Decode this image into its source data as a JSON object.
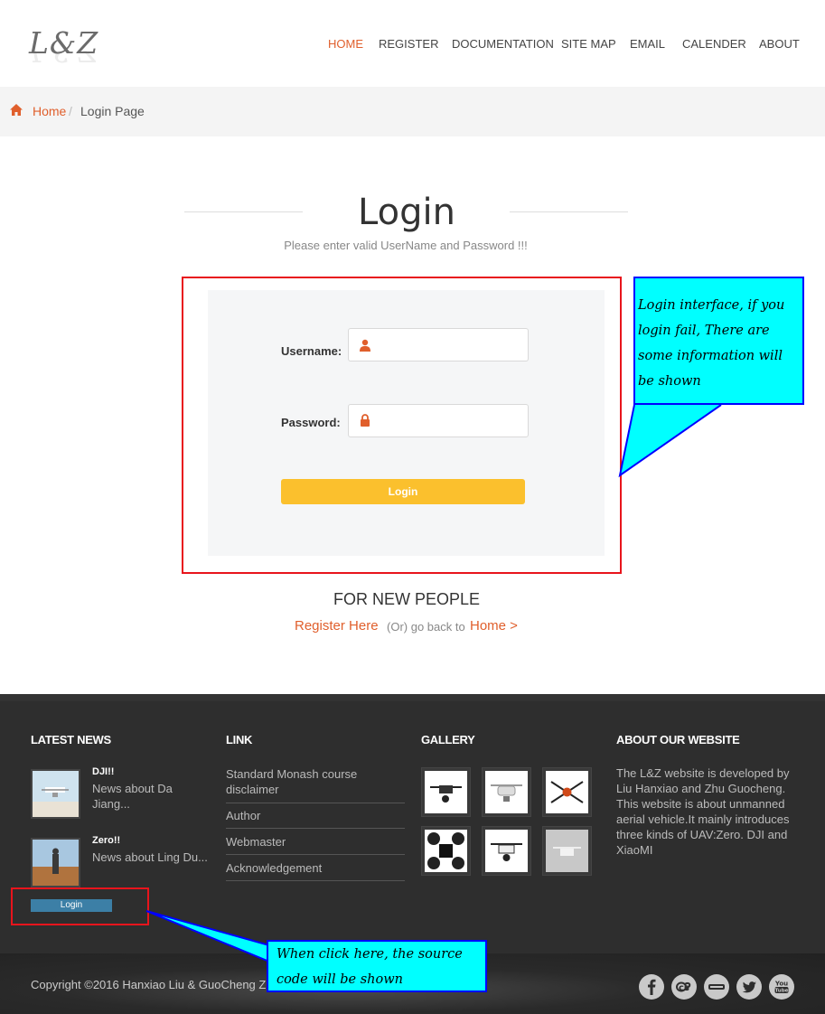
{
  "header": {
    "logo_text": "L&Z",
    "nav": [
      "HOME",
      "REGISTER",
      "DOCUMENTATION",
      "SITE MAP",
      "EMAIL",
      "CALENDER",
      "ABOUT"
    ],
    "active_nav": "HOME",
    "accent_color": "#e05f2c"
  },
  "breadcrumb": {
    "home": "Home",
    "separator": "/",
    "current": "Login Page"
  },
  "login": {
    "title": "Login",
    "subtitle": "Please enter valid UserName and Password !!!",
    "username_label": "Username:",
    "username_value": "",
    "password_label": "Password:",
    "password_value": "",
    "button_label": "Login",
    "button_color": "#fbc02d"
  },
  "annotation_login": {
    "lines": [
      "Login interface, if you",
      "login fail, There are",
      "some information will",
      "be shown"
    ]
  },
  "new_people": {
    "heading": "FOR NEW PEOPLE",
    "register_link": "Register Here",
    "or_text": "(Or) go back to",
    "home_link": "Home >"
  },
  "footer": {
    "latest_news_heading": "LATEST NEWS",
    "news": [
      {
        "title": "DJI!!",
        "text_line1": "News about Da",
        "text_line2": "Jiang..."
      },
      {
        "title": "Zero!!",
        "text_line1": "News about Ling Du...",
        "text_line2": ""
      }
    ],
    "source_button_label": "Login",
    "link_heading": "LINK",
    "links": [
      {
        "line1": "Standard Monash course",
        "line2": "disclaimer"
      },
      {
        "line1": "Author",
        "line2": ""
      },
      {
        "line1": "Webmaster",
        "line2": ""
      },
      {
        "line1": "Acknowledgement",
        "line2": ""
      }
    ],
    "gallery_heading": "GALLERY",
    "about_heading": "ABOUT OUR WEBSITE",
    "about_text": "The L&Z website is developed by Liu Hanxiao and Zhu Guocheng. This website is about unmanned aerial vehicle.It mainly introduces three kinds of UAV:Zero. DJI and XiaoMI",
    "copyright": "Copyright ©2016 Hanxiao Liu & GuoCheng Zh",
    "social_icons": [
      "facebook-icon",
      "lastfm-icon",
      "flickr-icon",
      "twitter-icon",
      "youtube-icon"
    ]
  },
  "annotation_source": {
    "lines": [
      "When click here, the source",
      "code will be shown"
    ]
  }
}
